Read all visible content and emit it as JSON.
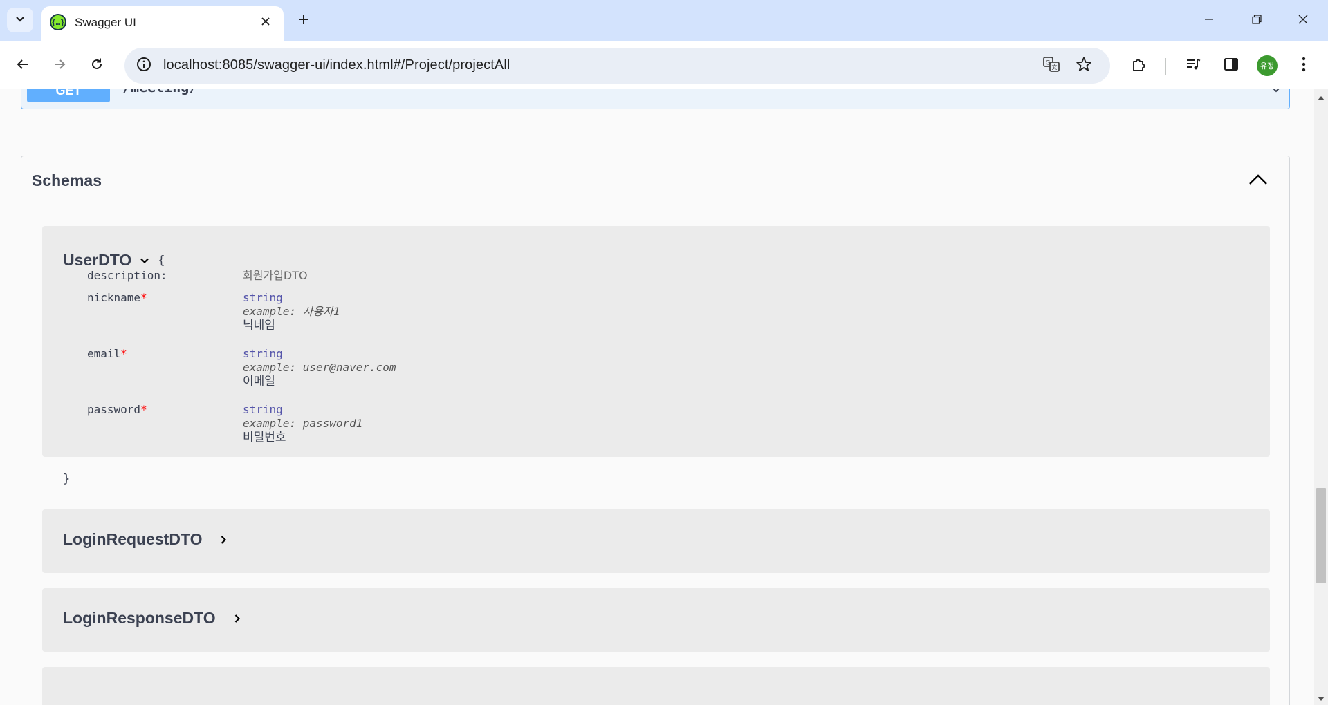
{
  "browser": {
    "tab_title": "Swagger UI",
    "favicon_glyph": "{…}",
    "url": "localhost:8085/swagger-ui/index.html#/Project/projectAll",
    "profile_initials": "유정"
  },
  "operation": {
    "method": "GET",
    "path": "/meeting/"
  },
  "schemas": {
    "title": "Schemas",
    "user_dto": {
      "name": "UserDTO",
      "open_brace": "{",
      "close_brace": "}",
      "description_label": "description:",
      "description_value": "회원가입DTO",
      "properties": [
        {
          "name": "nickname",
          "required": "*",
          "type": "string",
          "example": "example: 사용자1",
          "description": "닉네임"
        },
        {
          "name": "email",
          "required": "*",
          "type": "string",
          "example": "example: user@naver.com",
          "description": "이메일"
        },
        {
          "name": "password",
          "required": "*",
          "type": "string",
          "example": "example: password1",
          "description": "비밀번호"
        }
      ]
    },
    "collapsed_models": [
      {
        "name": "LoginRequestDTO"
      },
      {
        "name": "LoginResponseDTO"
      }
    ]
  }
}
